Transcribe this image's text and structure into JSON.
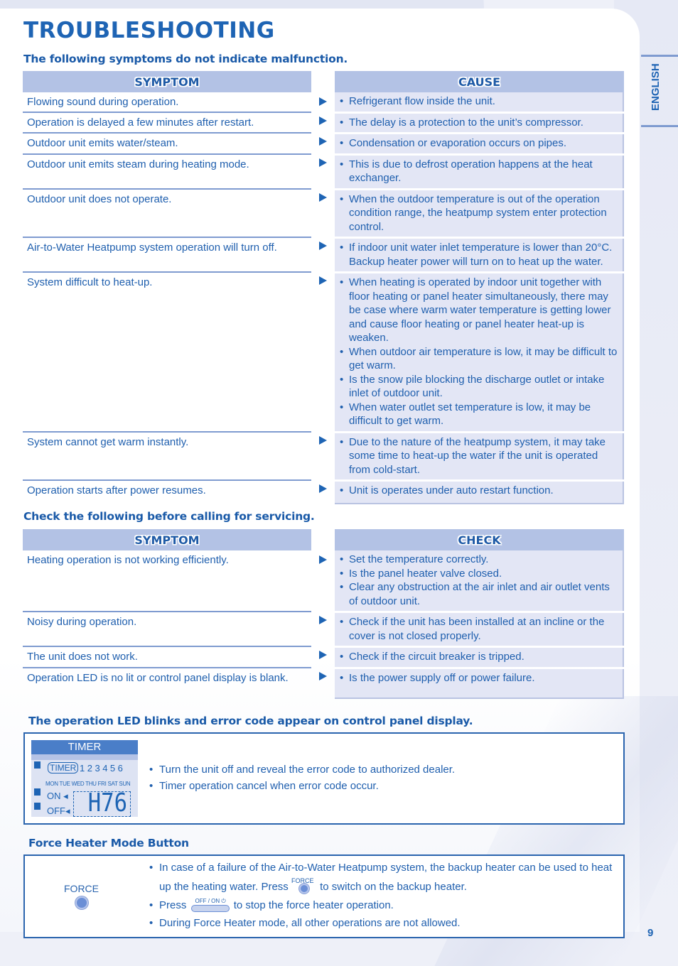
{
  "page": {
    "title": "TROUBLESHOOTING",
    "language_tab": "ENGLISH",
    "page_number": "9"
  },
  "section1": {
    "title": "The following symptoms do not indicate malfunction.",
    "header_left": "SYMPTOM",
    "header_right": "CAUSE",
    "rows": [
      {
        "symptom": "Flowing sound during operation.",
        "causes": [
          "Refrigerant flow inside the unit."
        ]
      },
      {
        "symptom": "Operation is delayed a few minutes after restart.",
        "causes": [
          "The delay is a protection to the unit’s compressor."
        ]
      },
      {
        "symptom": "Outdoor unit emits water/steam.",
        "causes": [
          "Condensation or evaporation occurs on pipes."
        ]
      },
      {
        "symptom": "Outdoor unit emits steam during heating mode.",
        "causes": [
          "This is due to defrost operation happens at the heat exchanger."
        ]
      },
      {
        "symptom": "Outdoor unit does not operate.",
        "causes": [
          "When the outdoor temperature is out of the operation condition range, the heatpump system enter protection control."
        ]
      },
      {
        "symptom": "Air-to-Water Heatpump system operation will turn off.",
        "causes": [
          "If indoor unit water inlet temperature is lower than 20°C. Backup heater power will turn on to heat up the water."
        ]
      },
      {
        "symptom": "System difficult to heat-up.",
        "causes": [
          "When heating is operated by indoor unit together with floor heating or panel heater simultaneously, there may be case where warm water temperature is getting lower and cause floor heating or panel heater heat-up is weaken.",
          "When outdoor air temperature is low, it may be difficult to get warm.",
          "Is the snow pile blocking the discharge outlet or intake inlet of outdoor unit.",
          "When water outlet set temperature is low, it may be difficult to get warm."
        ]
      },
      {
        "symptom": "System cannot get warm instantly.",
        "causes": [
          "Due to the nature of the heatpump system, it may take some time to heat-up the water if the unit is operated from cold-start."
        ]
      },
      {
        "symptom": "Operation starts after power resumes.",
        "causes": [
          "Unit is operates under auto restart function."
        ]
      }
    ]
  },
  "section2": {
    "title": "Check the following before calling for servicing.",
    "header_left": "SYMPTOM",
    "header_right": "CHECK",
    "rows": [
      {
        "symptom": "Heating operation is not working efficiently.",
        "checks": [
          "Set the temperature correctly.",
          "Is the panel heater valve closed.",
          "Clear any obstruction at the air inlet and air outlet vents of outdoor unit."
        ]
      },
      {
        "symptom": "Noisy during operation.",
        "checks": [
          "Check if the unit has been installed at an incline or the cover is not closed properly."
        ]
      },
      {
        "symptom": "The unit does not work.",
        "checks": [
          "Check if the circuit breaker is tripped."
        ]
      },
      {
        "symptom": "Operation LED is no lit or control panel display is blank.",
        "checks": [
          "Is the power supply off or power failure."
        ]
      }
    ]
  },
  "section3": {
    "title": "The operation LED blinks and error code appear on control panel display.",
    "lcd": {
      "header": "TIMER",
      "timer_label": "TIMER",
      "numbers": "123456",
      "days": "MON TUE WED THU FRI SAT SUN",
      "on_label": "ON",
      "off_label": "OFF",
      "error_code": "H76"
    },
    "bullets": [
      "Turn the unit off and reveal the error code to authorized dealer.",
      "Timer operation cancel when error code occur."
    ]
  },
  "section4": {
    "title": "Force Heater Mode Button",
    "button_label": "FORCE",
    "inline_force_label": "FORCE",
    "inline_offon_label": "OFF / ON",
    "bullet1_line1": "In case of a failure of the Air-to-Water Heatpump system, the backup heater can be used to heat",
    "bullet1_line2_before": "up the heating water. Press",
    "bullet1_line2_after": "to switch on the backup heater.",
    "bullet2_before": "Press",
    "bullet2_after": "to stop the force heater operation.",
    "bullet3": "During Force Heater mode, all other operations are not allowed."
  },
  "colors": {
    "primary": "#1e64b4",
    "header_bg": "#b3c2e5",
    "cell_bg": "#e3e6f5",
    "divider": "#7f9bd0"
  }
}
